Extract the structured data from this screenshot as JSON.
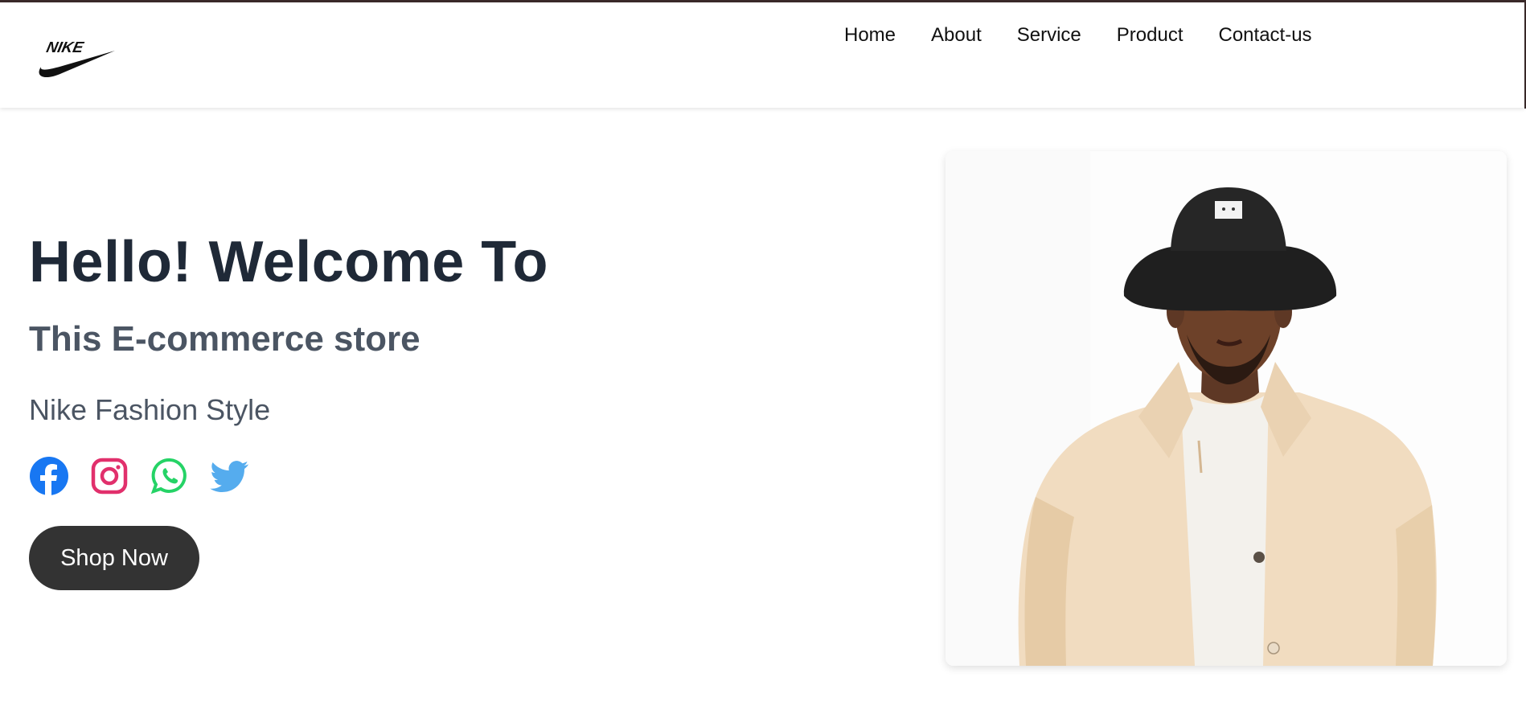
{
  "brand": {
    "name": "NIKE",
    "logo_icon": "nike-swoosh-logo"
  },
  "nav": {
    "items": [
      {
        "label": "Home"
      },
      {
        "label": "About"
      },
      {
        "label": "Service"
      },
      {
        "label": "Product"
      },
      {
        "label": "Contact-us"
      }
    ]
  },
  "hero": {
    "title": "Hello! Welcome To",
    "subtitle": "This E-commerce store",
    "tagline": "Nike Fashion Style",
    "cta_label": "Shop Now",
    "cta_color": "#333333",
    "image_icon": "model-photo"
  },
  "socials": [
    {
      "icon": "facebook-icon",
      "color": "#1877F2"
    },
    {
      "icon": "instagram-icon",
      "color": "#E1306C"
    },
    {
      "icon": "whatsapp-icon",
      "color": "#25D366"
    },
    {
      "icon": "twitter-icon",
      "color": "#55ACEE"
    }
  ]
}
